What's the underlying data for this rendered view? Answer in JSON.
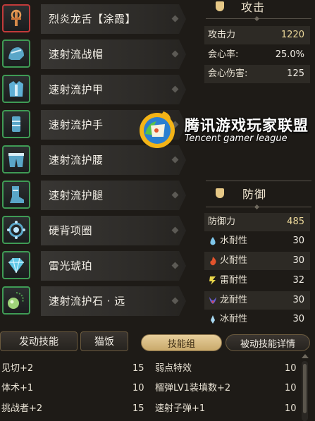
{
  "equipment": [
    {
      "name": "烈炎龙舌【涂霞】",
      "icon": "weapon-icon",
      "frame": "red"
    },
    {
      "name": "速射流战帽",
      "icon": "helmet-icon",
      "frame": "green"
    },
    {
      "name": "速射流护甲",
      "icon": "chest-armor-icon",
      "frame": "green"
    },
    {
      "name": "速射流护手",
      "icon": "gauntlet-icon",
      "frame": "green"
    },
    {
      "name": "速射流护腰",
      "icon": "waist-armor-icon",
      "frame": "green"
    },
    {
      "name": "速射流护腿",
      "icon": "leg-armor-icon",
      "frame": "green"
    },
    {
      "name": "硬背项圈",
      "icon": "necklace-icon",
      "frame": "green"
    },
    {
      "name": "雷光琥珀",
      "icon": "gem-icon",
      "frame": "green"
    },
    {
      "name": "速射流护石 · 远",
      "icon": "charm-icon",
      "frame": "green"
    }
  ],
  "attack": {
    "title": "攻击",
    "rows": [
      {
        "label": "攻击力",
        "value": "1220"
      },
      {
        "label": "会心率:",
        "value": "25.0%"
      },
      {
        "label": "会心伤害:",
        "value": "125"
      }
    ]
  },
  "defense": {
    "title": "防御",
    "rows": [
      {
        "label": "防御力",
        "value": "485",
        "icon": ""
      },
      {
        "label": "水耐性",
        "value": "30",
        "icon": "water-drop-icon"
      },
      {
        "label": "火耐性",
        "value": "30",
        "icon": "fire-icon"
      },
      {
        "label": "雷耐性",
        "value": "32",
        "icon": "lightning-icon"
      },
      {
        "label": "龙耐性",
        "value": "30",
        "icon": "dragon-icon"
      },
      {
        "label": "冰耐性",
        "value": "30",
        "icon": "ice-icon"
      }
    ]
  },
  "watermark": {
    "title": "腾讯游戏玩家联盟",
    "subtitle": "Tencent gamer league"
  },
  "tabs": {
    "skills": "发动技能",
    "cat": "猫饭",
    "skill_group": "技能组",
    "passive_detail": "被动技能详情"
  },
  "skills": [
    {
      "left": "见切+2",
      "left_value": "15",
      "right": "弱点特效",
      "right_value": "10"
    },
    {
      "left": "体术+1",
      "left_value": "10",
      "right": "榴弹LV1装填数+2",
      "right_value": "10"
    },
    {
      "left": "挑战者+2",
      "left_value": "15",
      "right": "速射子弹+1",
      "right_value": "10"
    }
  ],
  "colors": {
    "frame_green": "#3f9b55",
    "frame_red": "#c23a3a",
    "accent_gold": "#ecd89a",
    "background": "#1e1b17"
  }
}
